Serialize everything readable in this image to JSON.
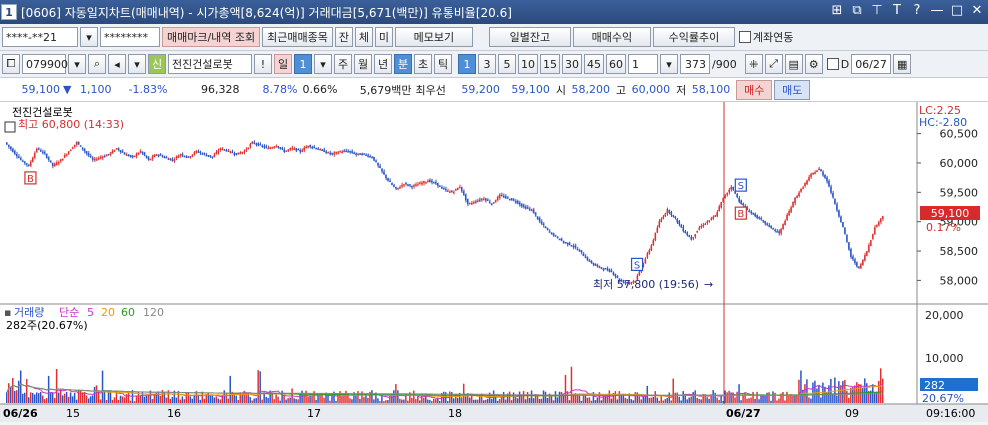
{
  "window": {
    "index": "1",
    "title": "[0606] 자동일지차트(매매내역) - 시가총액[8,624(억)] 거래대금[5,671(백만)] 유통비율[20.6]",
    "controls": [
      "⊞",
      "⧉",
      "⊤",
      "T",
      "?",
      "—",
      "□",
      "✕"
    ]
  },
  "toolbar1": {
    "account": "****-**21",
    "password": "********",
    "trade_mark_btn": "매매마크/내역 조회",
    "recent_btn": "최근매매종목",
    "tab_balance": "잔",
    "tab_fill": "체",
    "tab_unfilled": "미",
    "memo_btn": "메모보기",
    "daily_balance_btn": "일별잔고",
    "trade_profit_btn": "매매수익",
    "return_trend_btn": "수익률추이",
    "linked_label": "계좌연동"
  },
  "toolbar2": {
    "code": "079900",
    "credit": "신",
    "name": "전진건설로봇",
    "alert": "!",
    "period_day": "일",
    "period_num": "1",
    "periods": [
      "주",
      "월",
      "년",
      "분",
      "초",
      "틱"
    ],
    "minutes": [
      "1",
      "3",
      "5",
      "10",
      "15",
      "30",
      "45",
      "60"
    ],
    "interval": "1",
    "count": "373",
    "count_total": "/900",
    "d_label": "D",
    "date": "06/27"
  },
  "quote": {
    "price": "59,100",
    "change": "1,100",
    "change_pct": "-1.83%",
    "volume": "96,328",
    "vol_pct": "8.78%",
    "turnover": "0.66%",
    "amount": "5,679백만",
    "best_label": "최우선",
    "best_ask": "59,200",
    "best_bid": "59,100",
    "open_label": "시",
    "open": "58,200",
    "high_label": "고",
    "high": "60,000",
    "low_label": "저",
    "low": "58,100",
    "buy_btn": "매수",
    "sell_btn": "매도"
  },
  "chart_data": {
    "type": "candlestick",
    "title": "전진건설로봇",
    "high_label": "최고 60,800 (14:33)",
    "low_label": "최저 57,800 (19:56)",
    "y_ticks": [
      "60,500",
      "60,000",
      "59,500",
      "59,000",
      "58,500",
      "58,000"
    ],
    "ylim": [
      57700,
      60800
    ],
    "current_price": "59,100",
    "current_pct": "0.17%",
    "lc": "LC:2.25",
    "hc": "HC:-2.80",
    "x_labels": [
      "06/26",
      "15",
      "16",
      "17",
      "18",
      "06/27",
      "09"
    ],
    "time_label": "09:16:00",
    "trade_marks": [
      {
        "type": "B",
        "x_index": 3
      },
      {
        "type": "S",
        "x_index": 79
      },
      {
        "type": "B",
        "x_index": 92
      },
      {
        "type": "S",
        "x_index": 92
      }
    ],
    "path": [
      60350,
      60200,
      60050,
      59950,
      60250,
      60150,
      59950,
      60050,
      60200,
      60350,
      60200,
      60050,
      60100,
      60150,
      60250,
      60150,
      60100,
      60200,
      60050,
      60150,
      60100,
      60050,
      60150,
      60100,
      60200,
      60150,
      60100,
      60250,
      60200,
      60150,
      60200,
      60350,
      60300,
      60250,
      60300,
      60200,
      60250,
      60200,
      60300,
      60250,
      60200,
      60150,
      60200,
      60200,
      60150,
      60150,
      60100,
      59900,
      59700,
      59550,
      59650,
      59600,
      59650,
      59700,
      59650,
      59550,
      59500,
      59600,
      59300,
      59350,
      59400,
      59300,
      59450,
      59400,
      59350,
      59250,
      59200,
      59000,
      58850,
      58750,
      58650,
      58600,
      58500,
      58350,
      58250,
      58200,
      58150,
      58000,
      57950,
      58000,
      58300,
      58600,
      59000,
      59200,
      59050,
      58850,
      58700,
      58900,
      59000,
      59100,
      59400,
      59600,
      59350,
      59200,
      59100,
      59000,
      58900,
      58800,
      59100,
      59400,
      59600,
      59800,
      59900,
      59700,
      59300,
      58900,
      58400,
      58200,
      58500,
      58900,
      59100
    ],
    "volume": {
      "label": "거래량",
      "ma_label": "단순",
      "ma_periods": [
        "5",
        "20",
        "60",
        "120"
      ],
      "ma_colors": [
        "#cc33cc",
        "#e8a000",
        "#2a9a2a",
        "#888888"
      ],
      "current": "282주(20.67%)",
      "y_ticks": [
        "20,000",
        "10,000"
      ],
      "last": "282",
      "last_pct": "20.67%",
      "ylim": [
        0,
        20000
      ]
    },
    "colors": {
      "up": "#e23030",
      "down": "#2a55c8"
    }
  }
}
